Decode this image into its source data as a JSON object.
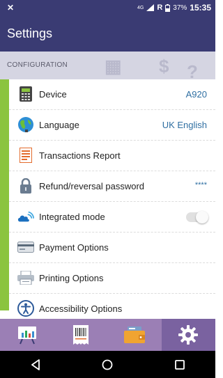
{
  "status_bar": {
    "network": "4G",
    "carrier": "R",
    "battery": "37%",
    "time": "15:35"
  },
  "header": {
    "title": "Settings"
  },
  "section": {
    "label": "CONFIGURATION"
  },
  "rows": [
    {
      "label": "Device",
      "value": "A920",
      "icon": "calculator-icon"
    },
    {
      "label": "Language",
      "value": "UK English",
      "icon": "globe-icon"
    },
    {
      "label": "Transactions Report",
      "value": "",
      "icon": "report-icon"
    },
    {
      "label": "Refund/reversal password",
      "value": "****",
      "icon": "lock-icon"
    },
    {
      "label": "Integrated mode",
      "value": "",
      "icon": "cloud-wifi-icon"
    },
    {
      "label": "Payment Options",
      "value": "",
      "icon": "card-icon"
    },
    {
      "label": "Printing Options",
      "value": "",
      "icon": "printer-icon"
    },
    {
      "label": "Accessibility Options",
      "value": "",
      "icon": "accessibility-icon"
    }
  ],
  "integrated_mode_enabled": false,
  "bottom_nav": {
    "tabs": [
      "chart-icon",
      "barcode-receipt-icon",
      "wallet-icon",
      "gear-icon"
    ],
    "active_tab": "gear-icon"
  },
  "colors": {
    "header": "#3a3b73",
    "accent": "#8bc43f",
    "bottom_nav": "#9b7fb5",
    "value_text": "#2f6fa2"
  }
}
